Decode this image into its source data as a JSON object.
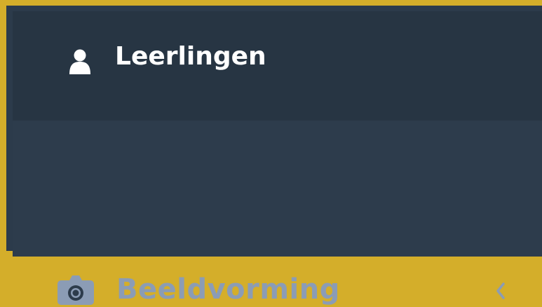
{
  "sidebar": {
    "items": [
      {
        "label": "Leerlingen",
        "icon": "user-icon",
        "state": "active"
      },
      {
        "label": "Beeldvorming",
        "icon": "camera-icon",
        "submenu_icon": "chevron-left-icon",
        "state": "inactive"
      }
    ]
  },
  "colors": {
    "frame_border": "#d4ae2a",
    "active_bg": "#273543",
    "inactive_bg": "#2d3c4c",
    "active_text": "#ffffff",
    "inactive_text": "#8b9cb5"
  }
}
